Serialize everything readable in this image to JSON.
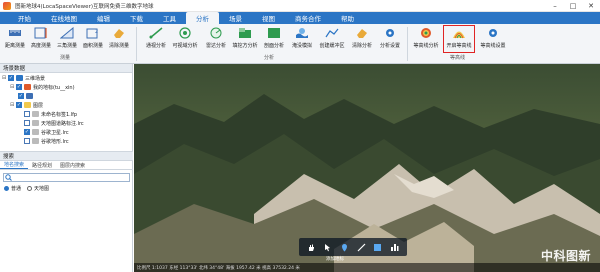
{
  "window": {
    "title": "图新地球4(LocaSpaceViewer)互联网免费三维数字地球",
    "minimize": "–",
    "maximize": "□",
    "close": "✕"
  },
  "menu": {
    "tabs": [
      {
        "label": "开始"
      },
      {
        "label": "在线地图"
      },
      {
        "label": "编辑"
      },
      {
        "label": "下载"
      },
      {
        "label": "工具"
      },
      {
        "label": "分析"
      },
      {
        "label": "场景"
      },
      {
        "label": "视图"
      },
      {
        "label": "商务合作"
      },
      {
        "label": "帮助"
      }
    ],
    "active": "分析"
  },
  "ribbon": {
    "groups": [
      {
        "label": "测量"
      },
      {
        "label": "分析"
      },
      {
        "label": "等高线"
      }
    ],
    "measure": [
      {
        "label": "距离测量",
        "icon": "ruler-icon"
      },
      {
        "label": "高度测量",
        "icon": "height-icon"
      },
      {
        "label": "三角测量",
        "icon": "triangle-icon"
      },
      {
        "label": "面积测量",
        "icon": "area-icon"
      },
      {
        "label": "清除测量",
        "icon": "eraser-icon"
      }
    ],
    "analysis": [
      {
        "label": "通视分析",
        "icon": "line-of-sight-icon"
      },
      {
        "label": "可视域分析",
        "icon": "viewshed-icon"
      },
      {
        "label": "雷达分析",
        "icon": "radar-icon"
      },
      {
        "label": "填挖方分析",
        "icon": "cut-fill-icon"
      },
      {
        "label": "剖面分析",
        "icon": "profile-icon"
      },
      {
        "label": "淹没模拟",
        "icon": "flood-icon"
      },
      {
        "label": "创建缓冲区",
        "icon": "buffer-icon"
      },
      {
        "label": "清除分析",
        "icon": "clear-analysis-icon"
      },
      {
        "label": "分析设置",
        "icon": "analysis-settings-icon"
      }
    ],
    "contour": [
      {
        "label": "等高线分析",
        "icon": "contour-icon"
      },
      {
        "label": "开启等高线",
        "icon": "toggle-contour-icon"
      },
      {
        "label": "等高线设置",
        "icon": "contour-settings-icon"
      }
    ]
  },
  "scene_panel": {
    "header": "场景数据",
    "tree": [
      {
        "label": "三维场景",
        "checked": true,
        "expander": "⊟"
      },
      {
        "label": "我的地标(tu__xin)",
        "checked": true,
        "expander": "⊟"
      },
      {
        "label": "",
        "checked": true,
        "expander": ""
      },
      {
        "label": "图层",
        "checked": true,
        "expander": "⊟"
      },
      {
        "label": "未命名标签1.lfp",
        "checked": false,
        "expander": ""
      },
      {
        "label": "天地图道路标注.lrc",
        "checked": false,
        "expander": ""
      },
      {
        "label": "谷歌卫星.lrc",
        "checked": true,
        "expander": ""
      },
      {
        "label": "谷歌地形.lrc",
        "checked": false,
        "expander": ""
      }
    ]
  },
  "search_panel": {
    "header": "搜索",
    "tabs": [
      {
        "label": "地名搜索"
      },
      {
        "label": "路径规划"
      },
      {
        "label": "图层内搜索"
      }
    ],
    "placeholder": "",
    "options": [
      {
        "label": "普通",
        "selected": true
      },
      {
        "label": "天地图",
        "selected": false
      }
    ]
  },
  "map": {
    "toolbar": [
      {
        "icon": "hand-pan-icon"
      },
      {
        "icon": "select-arrow-icon"
      },
      {
        "icon": "placemark-icon"
      },
      {
        "icon": "polyline-icon"
      },
      {
        "icon": "polygon-icon"
      },
      {
        "icon": "chart-icon"
      }
    ],
    "toolbar_label": "添加地标",
    "status": "比例尺 1:1037  东经 113°33'  北纬 34°48'  海拔 1957.42 米  视高 37532.24 米",
    "watermark": "中科图新"
  },
  "colors": {
    "accent": "#2b75c5",
    "highlight": "#e02424"
  }
}
